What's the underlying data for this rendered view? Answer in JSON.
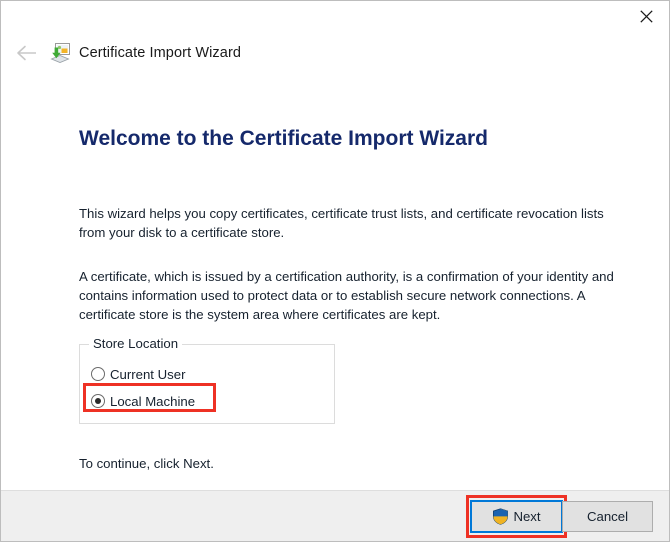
{
  "window": {
    "title": "Certificate Import Wizard",
    "close_label": "✕",
    "back_label": "Back",
    "icon_name": "certificate-import-icon"
  },
  "page": {
    "heading": "Welcome to the Certificate Import Wizard",
    "paragraph_1": "This wizard helps you copy certificates, certificate trust lists, and certificate revocation lists from your disk to a certificate store.",
    "paragraph_2": "A certificate, which is issued by a certification authority, is a confirmation of your identity and contains information used to protect data or to establish secure network connections. A certificate store is the system area where certificates are kept.",
    "continue_note": "To continue, click Next."
  },
  "store_location": {
    "legend": "Store Location",
    "options": [
      {
        "label": "Current User",
        "selected": false
      },
      {
        "label": "Local Machine",
        "selected": true
      }
    ],
    "selected_value": "Local Machine"
  },
  "footer": {
    "next_label": "Next",
    "cancel_label": "Cancel",
    "next_shield_icon": "uac-shield-icon"
  },
  "colors": {
    "heading": "#15296b",
    "annotation_highlight": "#ee3124",
    "focus_border": "#0078d7",
    "footer_background": "#efefef",
    "shield_blue": "#1b63b0",
    "shield_gold": "#f0b323"
  }
}
